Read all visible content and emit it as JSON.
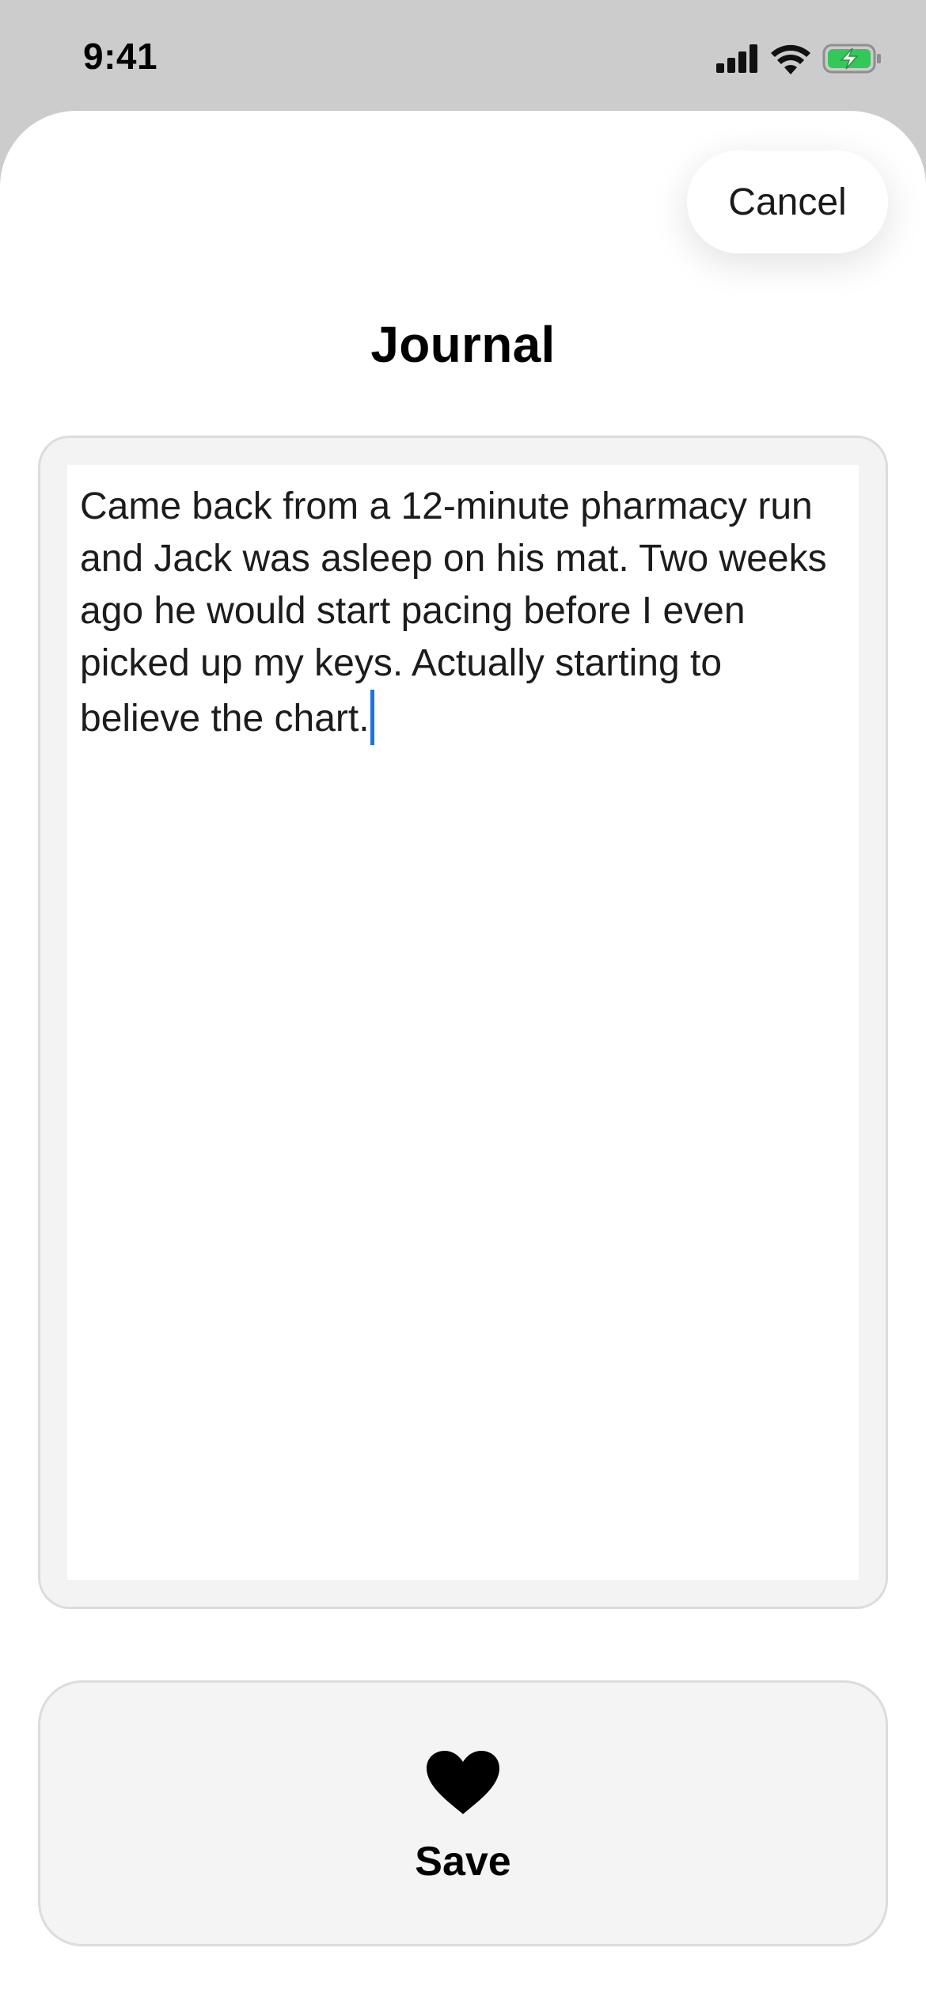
{
  "status_bar": {
    "time": "9:41",
    "icons": [
      "cellular-signal-icon",
      "wifi-icon",
      "battery-charging-icon"
    ],
    "battery_color": "#34c759"
  },
  "sheet": {
    "cancel_label": "Cancel",
    "title": "Journal"
  },
  "editor": {
    "value": "Came back from a 12-minute pharmacy run and Jack was asleep on his mat. Two weeks ago he would start pacing before I even picked up my keys. Actually starting to believe the chart.",
    "caret_color": "#1a73e8"
  },
  "save_button": {
    "label": "Save",
    "icon": "heart-icon"
  }
}
